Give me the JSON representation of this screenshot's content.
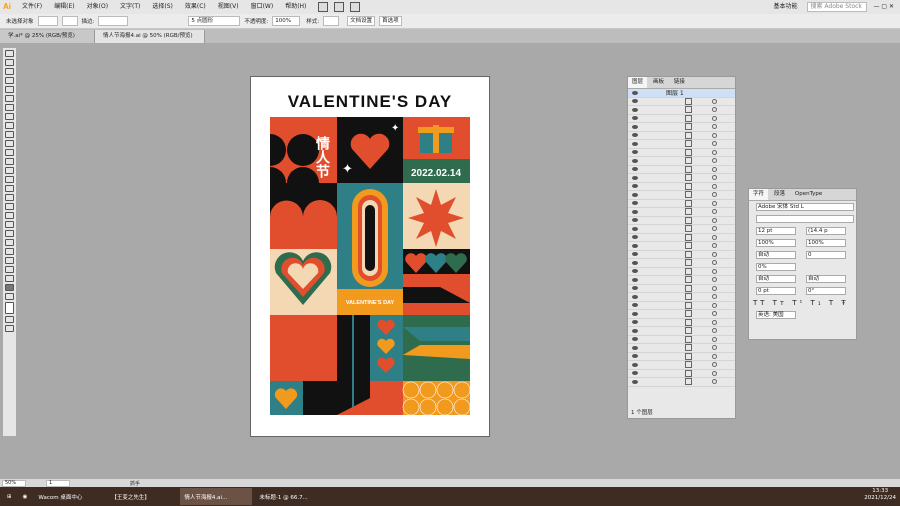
{
  "menu": {
    "logo": "Ai",
    "items": [
      "文件(F)",
      "编辑(E)",
      "对象(O)",
      "文字(T)",
      "选择(S)",
      "效果(C)",
      "视图(V)",
      "窗口(W)",
      "帮助(H)"
    ],
    "workspace": "基本功能",
    "search_placeholder": "搜索 Adobe Stock"
  },
  "control": {
    "selection": "未选择对象",
    "stroke_label": "描边:",
    "brush": "5 点圆形",
    "opacity_label": "不透明度:",
    "opacity": "100%",
    "style_label": "样式:",
    "doc_setup": "文档设置",
    "prefs": "首选项"
  },
  "tabs": [
    "学.ai* @ 25% (RGB/预览)",
    "情人节海报4.ai @ 50% (RGB/预览)"
  ],
  "poster": {
    "title": "VALENTINE'S  DAY",
    "cn": "情人节",
    "date": "2022.02.14",
    "sub": "VALENTINE'S DAY"
  },
  "layers": {
    "tabs": [
      "图层",
      "画板",
      "链接"
    ],
    "layer_name": "图层 1",
    "footer": "1 个图层"
  },
  "character": {
    "tabs": [
      "字符",
      "段落",
      "OpenType"
    ],
    "font": "Adobe 宋体 Std L",
    "size": "12 pt",
    "leading": "(14.4 p",
    "scale_h": "100%",
    "scale_v": "100%",
    "kern": "自动",
    "track": "0",
    "shift": "0%",
    "auto": "自动",
    "baseline": "0 pt",
    "rotate": "0°",
    "lang": "英语: 美国"
  },
  "status": {
    "zoom": "50%",
    "page": "1",
    "mode": "抓手"
  },
  "taskbar": {
    "items": [
      "Wacom 桌面中心",
      "【王变之先生】",
      "情人节海报4.ai...",
      "未标题-1 @ 66.7..."
    ],
    "time": "13:33",
    "date": "2021/12/24"
  },
  "colors": {
    "red": "#e04e2e",
    "orange": "#f29a1e",
    "teal": "#2f7f86",
    "green": "#2f6b4d",
    "beige": "#f4d8b4",
    "black": "#111111"
  }
}
